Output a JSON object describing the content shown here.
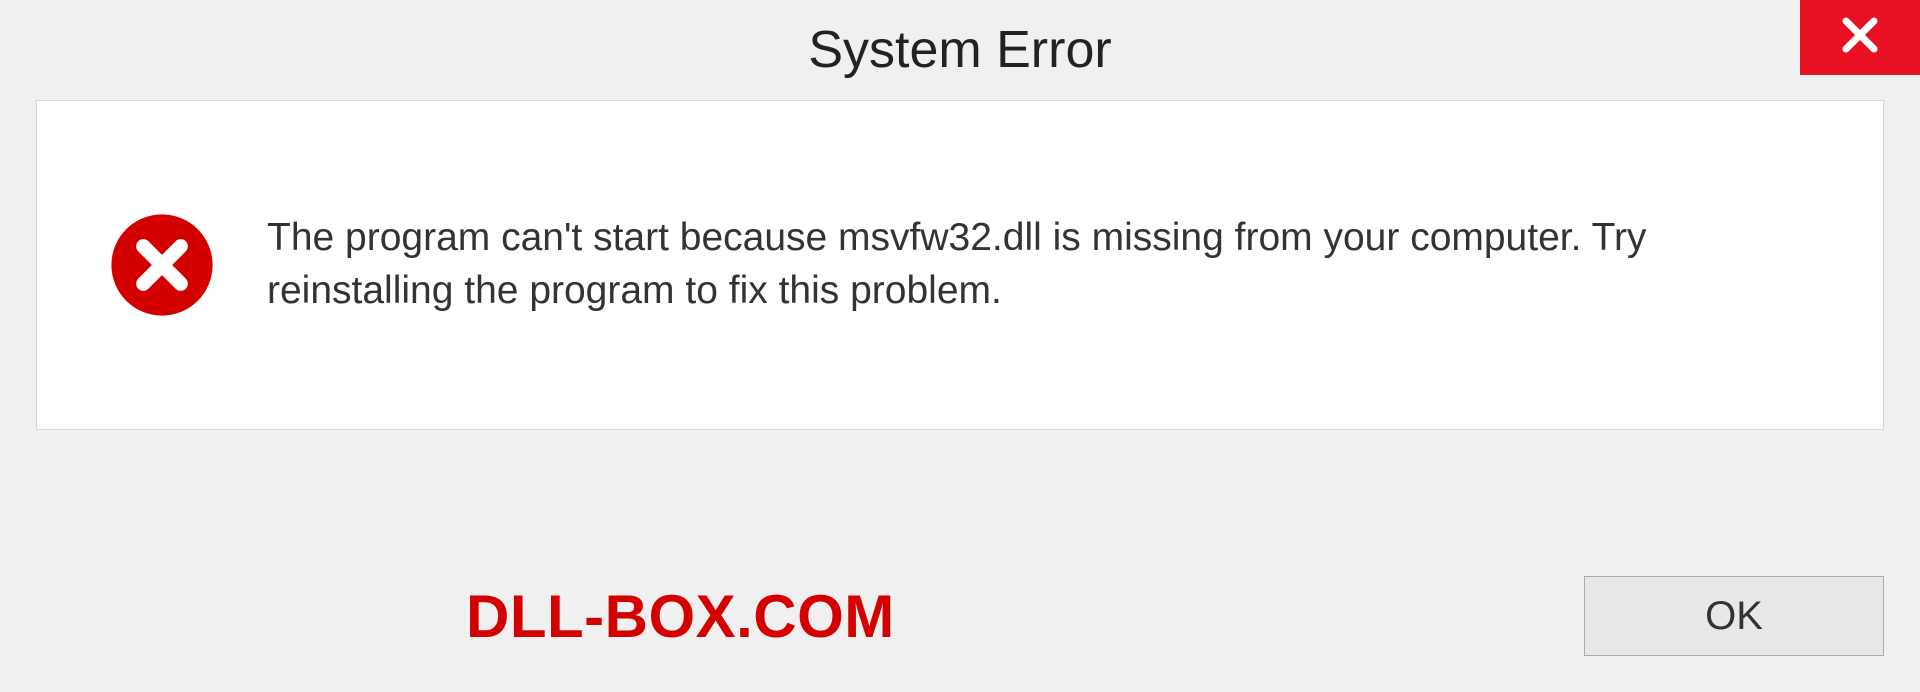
{
  "titlebar": {
    "title": "System Error"
  },
  "dialog": {
    "message": "The program can't start because msvfw32.dll is missing from your computer. Try reinstalling the program to fix this problem."
  },
  "footer": {
    "watermark": "DLL-BOX.COM",
    "ok_label": "OK"
  },
  "icons": {
    "close": "close-icon",
    "error": "error-circle-x-icon"
  },
  "colors": {
    "close_bg": "#e81123",
    "error_red": "#d40000",
    "panel_bg": "#ffffff",
    "page_bg": "#f0f0f0"
  }
}
